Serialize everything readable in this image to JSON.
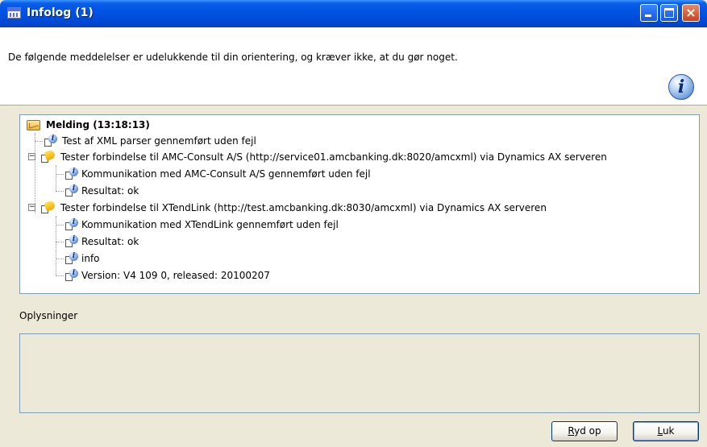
{
  "window": {
    "title": "Infolog (1)",
    "minimize": "minimize",
    "maximize": "maximize",
    "close": "×"
  },
  "header": {
    "message": "De følgende meddelelser er udelukkende til din orientering, og kræver ikke, at du gør noget."
  },
  "tree": {
    "root": "Melding (13:18:13)",
    "nodes": [
      {
        "text": "Test af XML parser gennemført uden fejl",
        "icon": "info-icon"
      },
      {
        "text": "Tester forbindelse til AMC-Consult A/S (http://service01.amcbanking.dk:8020/amcxml) via Dynamics AX serveren",
        "icon": "warning-icon"
      },
      {
        "text": "Kommunikation med AMC-Consult A/S gennemført uden fejl",
        "icon": "info-icon"
      },
      {
        "text": "Resultat: ok",
        "icon": "info-icon"
      },
      {
        "text": "Tester forbindelse til XTendLink (http://test.amcbanking.dk:8030/amcxml) via Dynamics AX serveren",
        "icon": "warning-icon"
      },
      {
        "text": "Kommunikation med XTendLink gennemført uden fejl",
        "icon": "info-icon"
      },
      {
        "text": "Resultat: ok",
        "icon": "info-icon"
      },
      {
        "text": "info",
        "icon": "info-icon"
      },
      {
        "text": "Version: V4 109 0, released: 20100207",
        "icon": "info-icon"
      }
    ],
    "expander_symbol": "−"
  },
  "details": {
    "label": "Oplysninger",
    "content": ""
  },
  "buttons": {
    "clear_prefix": "R",
    "clear_rest": "yd op",
    "close_prefix": "L",
    "close_rest": "uk"
  }
}
